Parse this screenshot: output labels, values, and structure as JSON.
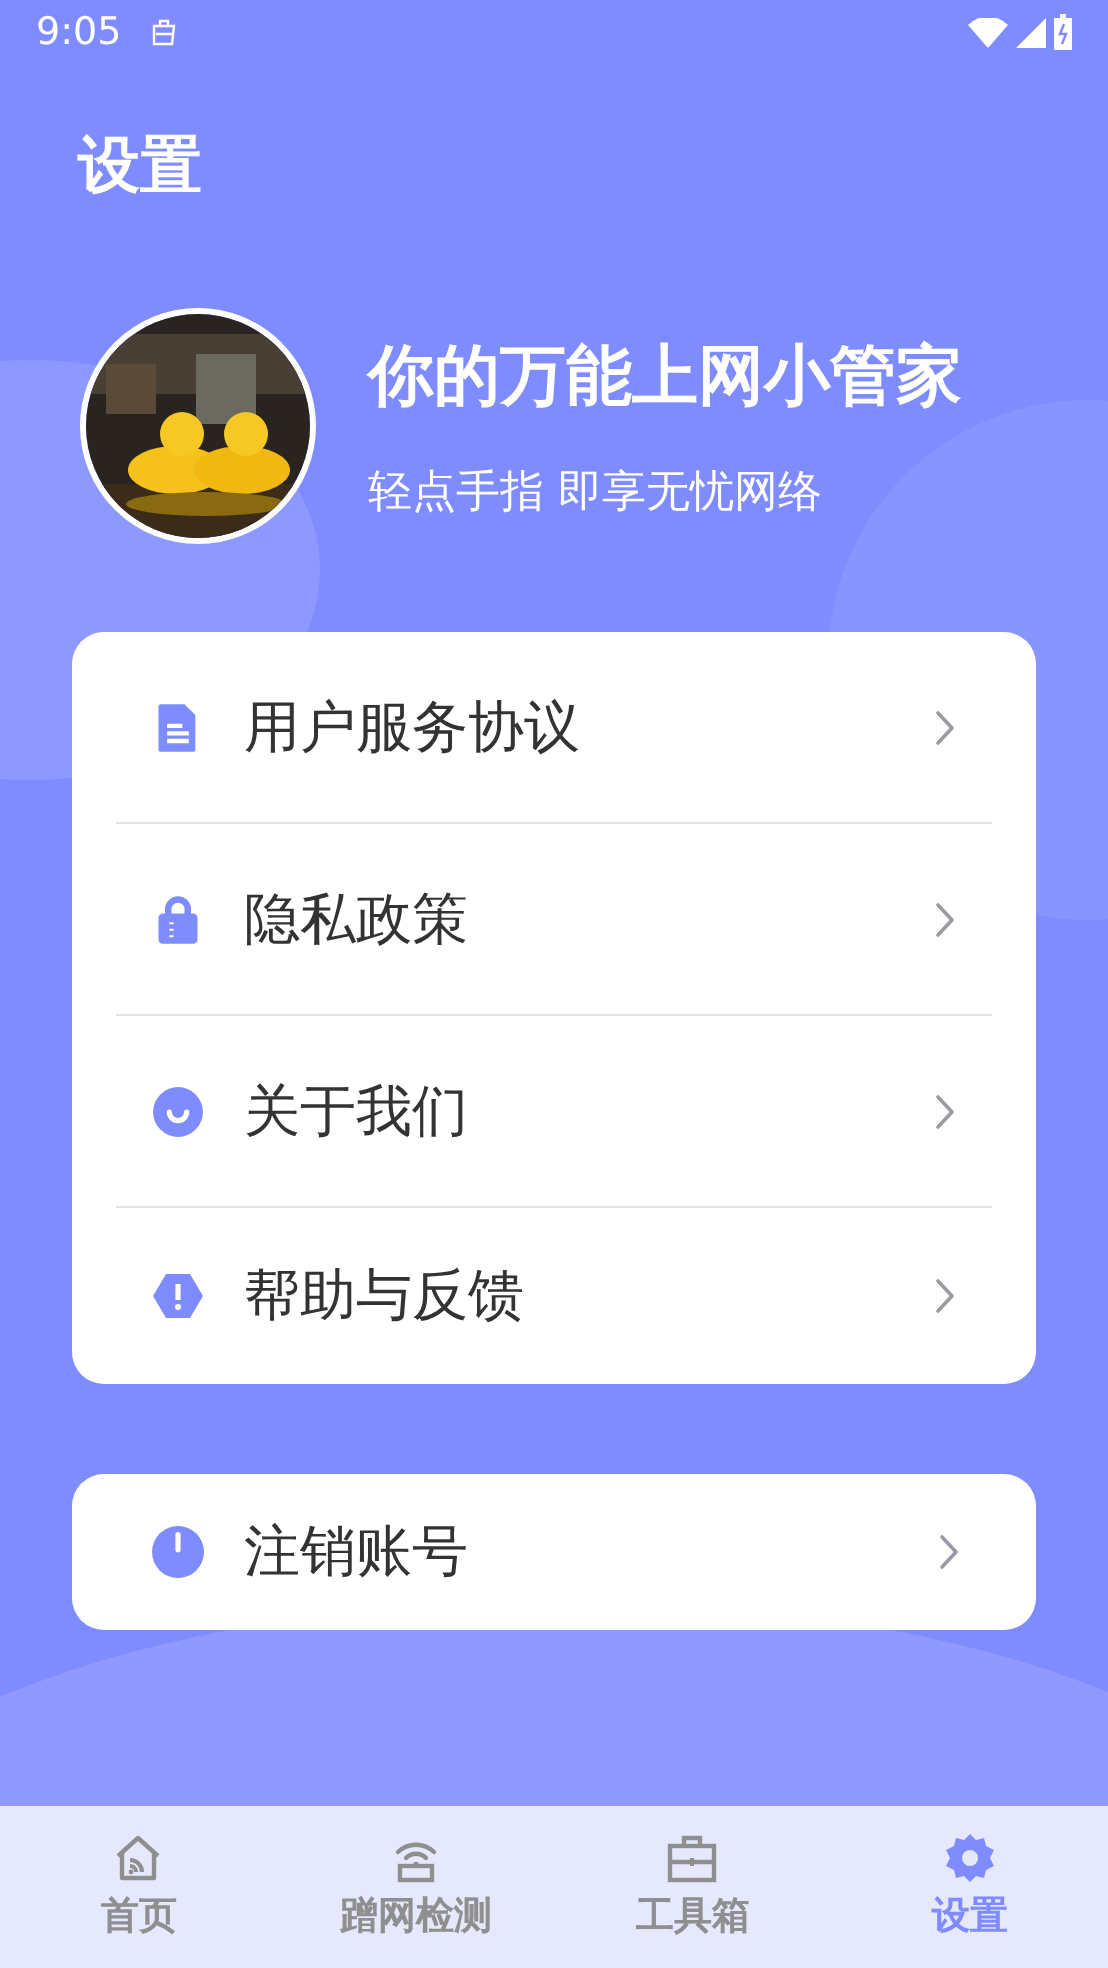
{
  "status_bar": {
    "time": "9:05"
  },
  "title": "设置",
  "profile": {
    "name": "你的万能上网小管家",
    "tagline": "轻点手指 即享无忧网络"
  },
  "menu": [
    {
      "kind": "document",
      "label": "用户服务协议"
    },
    {
      "kind": "lock",
      "label": "隐私政策"
    },
    {
      "kind": "smile",
      "label": "关于我们"
    },
    {
      "kind": "warning",
      "label": "帮助与反馈"
    }
  ],
  "account": {
    "kind": "power",
    "label": "注销账号"
  },
  "tabs": [
    {
      "kind": "home",
      "label": "首页",
      "selected": false
    },
    {
      "kind": "router",
      "label": "蹭网检测",
      "selected": false
    },
    {
      "kind": "toolbox",
      "label": "工具箱",
      "selected": false
    },
    {
      "kind": "gear",
      "label": "设置",
      "selected": true
    }
  ]
}
